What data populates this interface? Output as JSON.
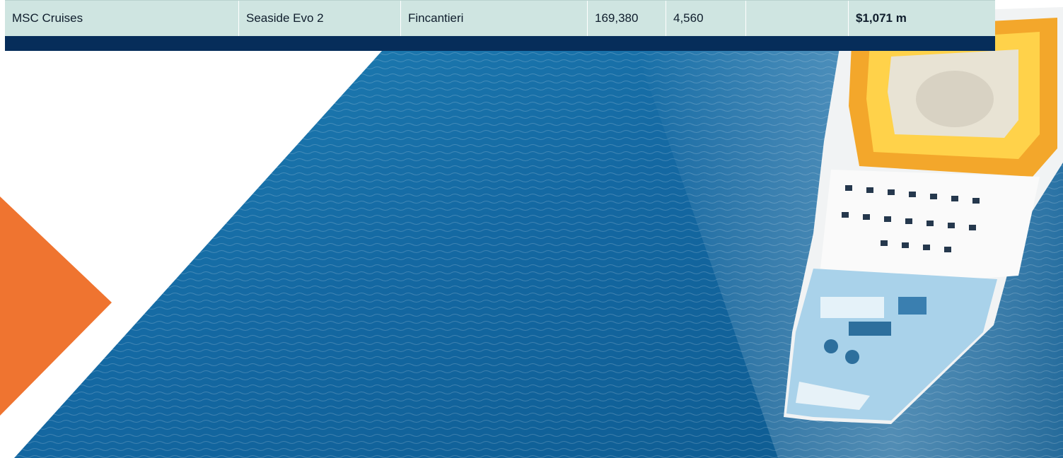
{
  "table": {
    "row": {
      "operator": "MSC Cruises",
      "ship": "Seaside Evo 2",
      "shipyard": "Fincantieri",
      "tonnage": "169,380",
      "capacity": "4,560",
      "blank": "",
      "cost": "$1,071 m"
    }
  },
  "colors": {
    "row_bg": "#cfe5e1",
    "footer_bar": "#062d5a",
    "accent_orange": "#ef7430",
    "sea_blue": "#1a6a9e"
  },
  "icons": [
    "cruise-ship-photo",
    "orange-triangle-decoration"
  ]
}
